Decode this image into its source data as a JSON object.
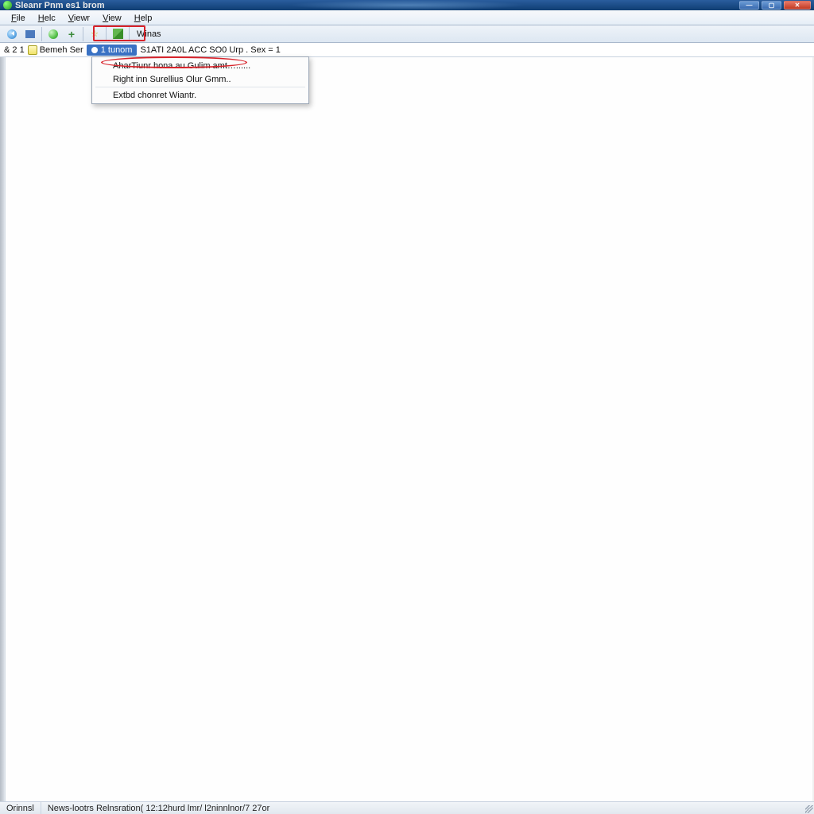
{
  "title": "Sleanr Pnm es1 brom",
  "menu": [
    "File",
    "Helc",
    "Viewr",
    "View",
    "Help"
  ],
  "toolbar": {
    "wiring_label": "Winas"
  },
  "addressbar": {
    "seg1": "& 2 1",
    "seg2": "Bemeh Ser",
    "pill": "1 tunom",
    "rest": "S1ATI 2A0L  ACC SO0 Urp .   Sex = 1"
  },
  "dropdown": {
    "items": [
      "AharTiunr hona au Gulim amt…......",
      "Right inn Surellius Olur Gmm..",
      "Extbd chonret Wiantr."
    ]
  },
  "status": {
    "seg1": "Orinnsl",
    "seg2": "News-lootrs Relnsration( 12:12hurd lmr/ l2ninnlnor/7 27or"
  }
}
